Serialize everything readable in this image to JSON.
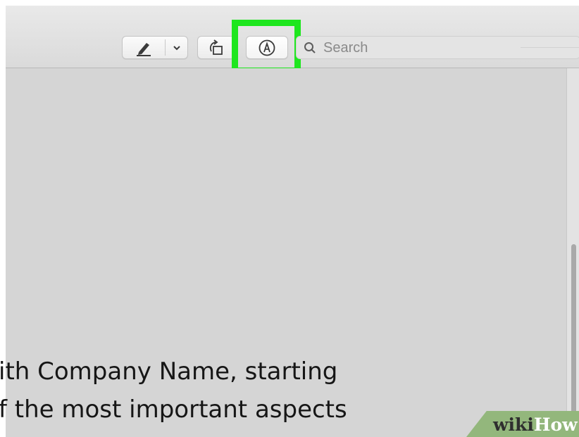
{
  "toolbar": {
    "markup_tools": {
      "pen_icon": "pen-icon",
      "chevron_icon": "chevron-down-icon"
    },
    "rotate_icon": "rotate-icon",
    "markup_icon": "markup-icon",
    "search": {
      "placeholder": "Search",
      "icon": "search-icon"
    }
  },
  "document": {
    "lines": [
      "ith Company Name, starting",
      "f the most important aspects"
    ]
  },
  "watermark": {
    "wiki": "wiki",
    "how": "How"
  },
  "colors": {
    "highlight": "#1ee61e",
    "background": "#d5d5d5",
    "watermark_bg": "#93b77c"
  }
}
